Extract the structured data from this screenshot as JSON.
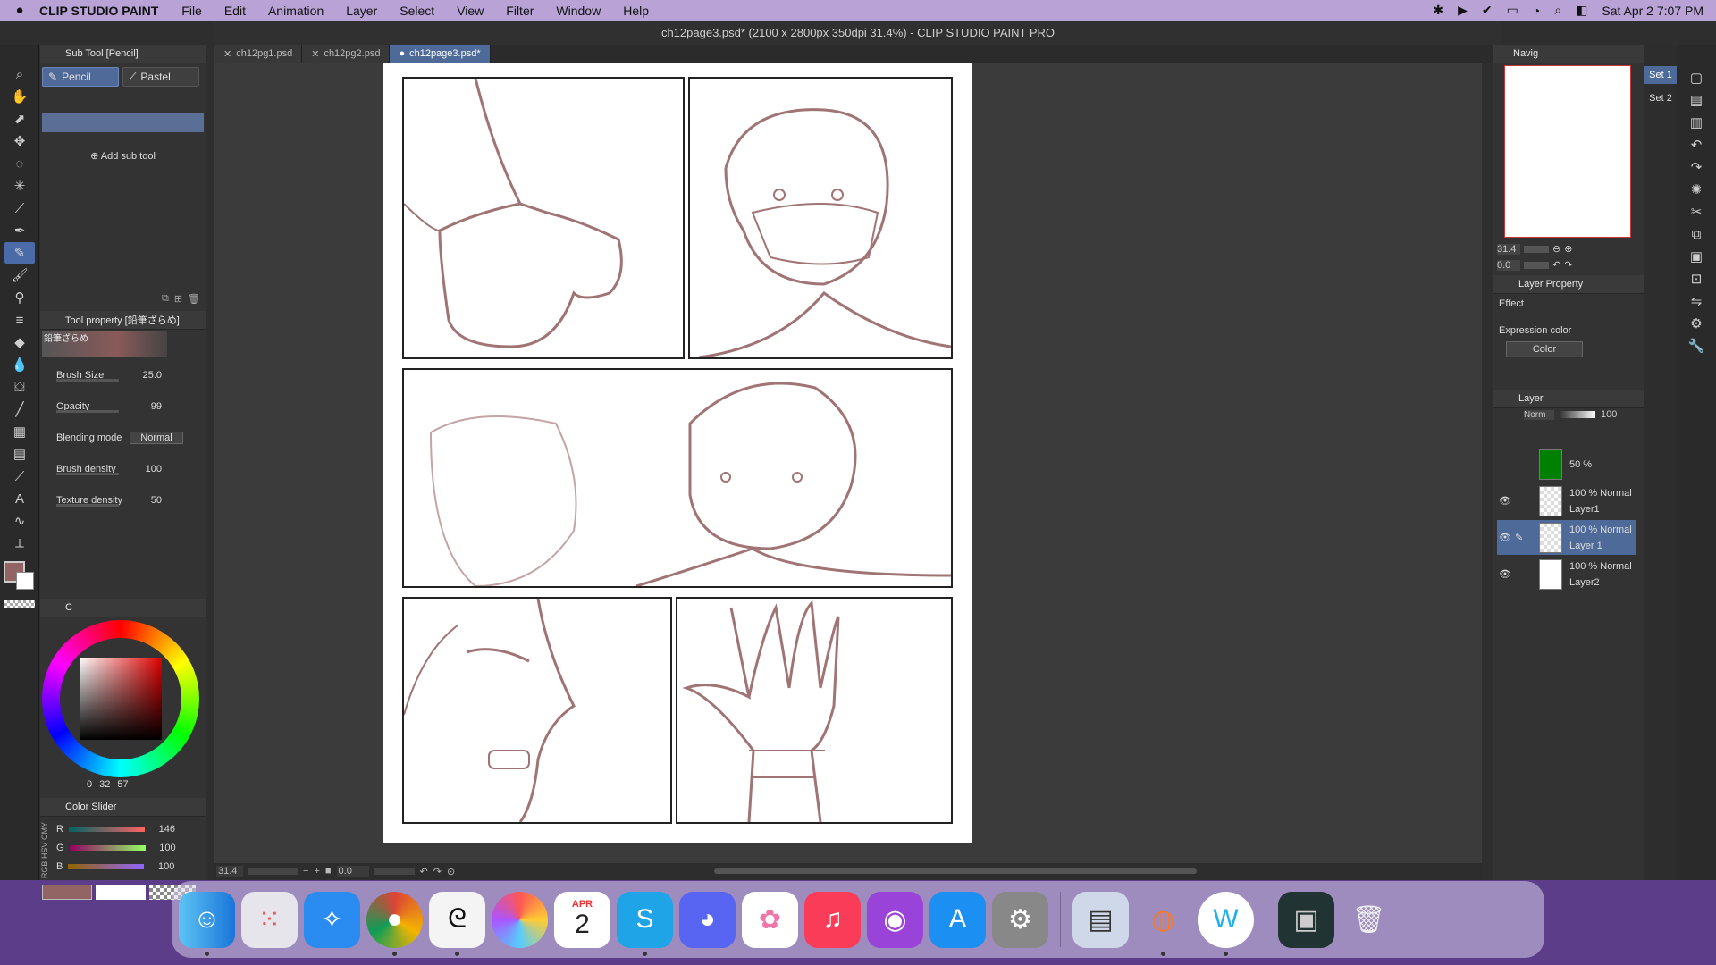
{
  "menubar": {
    "app_name": "CLIP STUDIO PAINT",
    "items": [
      "File",
      "Edit",
      "Animation",
      "Layer",
      "Select",
      "View",
      "Filter",
      "Window",
      "Help"
    ],
    "datetime": "Sat Apr 2  7:07 PM"
  },
  "window": {
    "title": "ch12page3.psd* (2100 x 2800px 350dpi 31.4%)  - CLIP STUDIO PAINT PRO"
  },
  "doc_tabs": [
    "ch12pg1.psd",
    "ch12pg2.psd",
    "ch12page3.psd*"
  ],
  "sub_tool": {
    "header": "Sub Tool [Pencil]",
    "tabs": [
      "Pencil",
      "Pastel"
    ],
    "add_label": "Add sub tool"
  },
  "tool_property": {
    "header": "Tool property [鉛筆ざらめ]",
    "brush_name": "鉛筆ざらめ",
    "rows": [
      {
        "label": "Brush Size",
        "value": "25.0"
      },
      {
        "label": "Opacity",
        "value": "99"
      },
      {
        "label": "Blending mode",
        "value": "Normal"
      },
      {
        "label": "Brush density",
        "value": "100"
      },
      {
        "label": "Texture density",
        "value": "50"
      }
    ]
  },
  "color_wheel": {
    "tab": "C",
    "values": [
      "0",
      "32",
      "57"
    ]
  },
  "color_slider": {
    "header": "Color Slider",
    "rows": [
      {
        "label": "R",
        "value": "146"
      },
      {
        "label": "G",
        "value": "100"
      },
      {
        "label": "B",
        "value": "100"
      }
    ],
    "side_labels": [
      "RGB",
      "HSV",
      "CMY"
    ]
  },
  "colors": {
    "main_color": "#926464",
    "accent": "#4d6a98",
    "layer_green": "#008000"
  },
  "navigator": {
    "tab": "Navig",
    "zoom": "31.4",
    "angle": "0.0"
  },
  "sets": [
    "Set 1",
    "Set 2"
  ],
  "layer_property": {
    "header": "Layer Property",
    "effect_label": "Effect",
    "expression_label": "Expression color",
    "expression_value": "Color"
  },
  "layers": {
    "header": "Layer",
    "blend": "Norm",
    "opacity": "100",
    "items": [
      {
        "line1": "50 %",
        "line2": ""
      },
      {
        "line1": "100 % Normal",
        "line2": "Layer1"
      },
      {
        "line1": "100 % Normal",
        "line2": "Layer 1"
      },
      {
        "line1": "100 % Normal",
        "line2": "Layer2"
      }
    ]
  },
  "status": {
    "zoom": "31.4",
    "angle": "0.0"
  },
  "dock": {
    "calendar_month": "APR",
    "calendar_day": "2",
    "apps": [
      "finder-icon",
      "launchpad-icon",
      "safari-icon",
      "chrome-icon",
      "clip-studio-icon",
      "paint-icon",
      "calendar-icon",
      "skype-icon",
      "discord-icon",
      "photos-icon",
      "music-icon",
      "podcasts-icon",
      "app-store-icon",
      "system-preferences-icon",
      "preview-icon",
      "blender-icon",
      "word-icon",
      "screen-recording-icon",
      "trash-icon"
    ]
  }
}
